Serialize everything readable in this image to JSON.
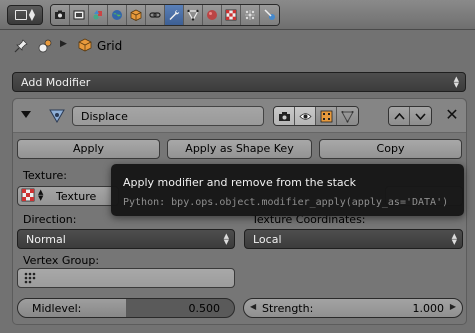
{
  "header": {
    "context_tabs": [
      {
        "name": "render",
        "active": false
      },
      {
        "name": "render-layers",
        "active": false
      },
      {
        "name": "scene",
        "active": false
      },
      {
        "name": "world",
        "active": false
      },
      {
        "name": "object",
        "active": false
      },
      {
        "name": "constraints",
        "active": false
      },
      {
        "name": "modifiers",
        "active": true
      },
      {
        "name": "data",
        "active": false
      },
      {
        "name": "material",
        "active": false
      },
      {
        "name": "texture",
        "active": false
      },
      {
        "name": "particles",
        "active": false
      },
      {
        "name": "physics",
        "active": false
      }
    ]
  },
  "breadcrumb": {
    "object": "Grid"
  },
  "add_modifier_label": "Add Modifier",
  "modifier": {
    "name": "Displace",
    "apply_label": "Apply",
    "apply_shape_label": "Apply as Shape Key",
    "copy_label": "Copy",
    "texture_label": "Texture:",
    "texture_name": "Texture",
    "direction_label": "Direction:",
    "direction_value": "Normal",
    "texcoords_label": "Texture Coordinates:",
    "texcoords_value": "Local",
    "vertex_group_label": "Vertex Group:",
    "vertex_group_value": "",
    "midlevel_label": "Midlevel:",
    "midlevel_value": "0.500",
    "midlevel_fraction": 0.5,
    "strength_label": "Strength:",
    "strength_value": "1.000"
  },
  "tooltip": {
    "title": "Apply modifier and remove from the stack",
    "python": "Python: bpy.ops.object.modifier_apply(apply_as='DATA')"
  },
  "colors": {
    "active_tab": "#4f74ad",
    "tooltip_bg": "#161616"
  }
}
